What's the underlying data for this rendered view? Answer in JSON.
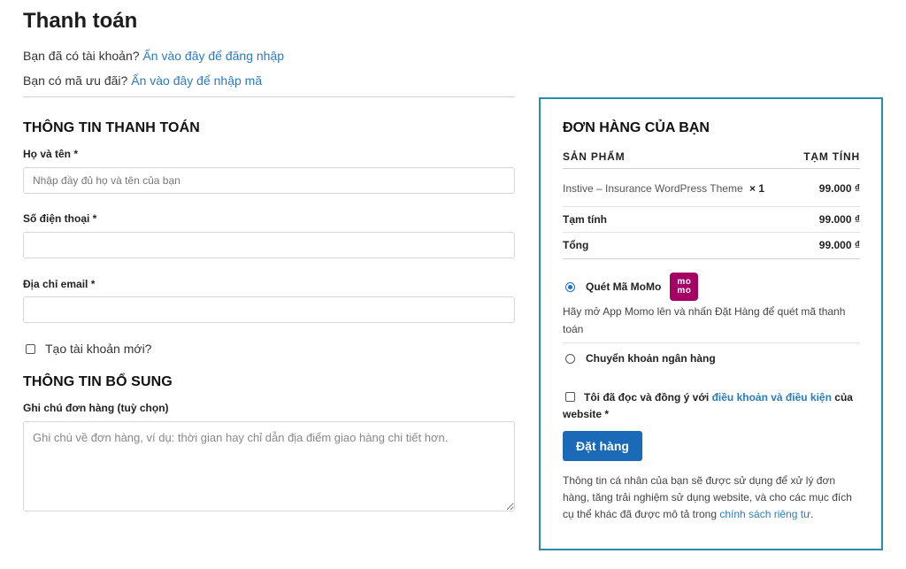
{
  "page": {
    "title": "Thanh toán"
  },
  "notices": {
    "login_text": "Bạn đã có tài khoản?",
    "login_link": "Ấn vào đây để đăng nhập",
    "coupon_text": "Bạn có mã ưu đãi?",
    "coupon_link": "Ấn vào đây để nhập mã"
  },
  "billing": {
    "section_title": "THÔNG TIN THANH TOÁN",
    "name_label": "Họ và tên *",
    "name_placeholder": "Nhập đầy đủ họ và tên của bạn",
    "phone_label": "Số điện thoại *",
    "email_label": "Địa chỉ email *",
    "create_account_label": "Tạo tài khoản mới?"
  },
  "additional": {
    "section_title": "THÔNG TIN BỔ SUNG",
    "notes_label": "Ghi chú đơn hàng (tuỳ chọn)",
    "notes_placeholder": "Ghi chú về đơn hàng, ví dụ: thời gian hay chỉ dẫn địa điểm giao hàng chi tiết hơn."
  },
  "order": {
    "title": "ĐƠN HÀNG CỦA BẠN",
    "col_product": "SẢN PHẨM",
    "col_subtotal": "TẠM TÍNH",
    "item_name": "Instive – Insurance WordPress Theme",
    "item_qty": "× 1",
    "item_price": "99.000 ₫",
    "subtotal_label": "Tạm tính",
    "subtotal_value": "99.000 ₫",
    "total_label": "Tổng",
    "total_value": "99.000 ₫"
  },
  "payment": {
    "momo_label": "Quét Mã MoMo",
    "momo_logo_top": "mo",
    "momo_logo_bottom": "mo",
    "momo_desc": "Hãy mở App Momo lên và nhấn Đặt Hàng để quét mã thanh toán",
    "bank_label": "Chuyển khoản ngân hàng",
    "selected": "momo"
  },
  "terms": {
    "prefix": "Tôi đã đọc và đồng ý với",
    "link": "điều khoản và điều kiện",
    "suffix": "của website *"
  },
  "place_order_label": "Đặt hàng",
  "privacy": {
    "text": "Thông tin cá nhân của bạn sẽ được sử dụng để xử lý đơn hàng, tăng trải nghiệm sử dụng website, và cho các mục đích cụ thể khác đã được mô tả trong",
    "link": "chính sách riêng tư",
    "end": "."
  },
  "colors": {
    "link": "#2b7bc0",
    "order_border": "#2d8ab0",
    "button": "#1a6ab8",
    "momo": "#a50064"
  }
}
